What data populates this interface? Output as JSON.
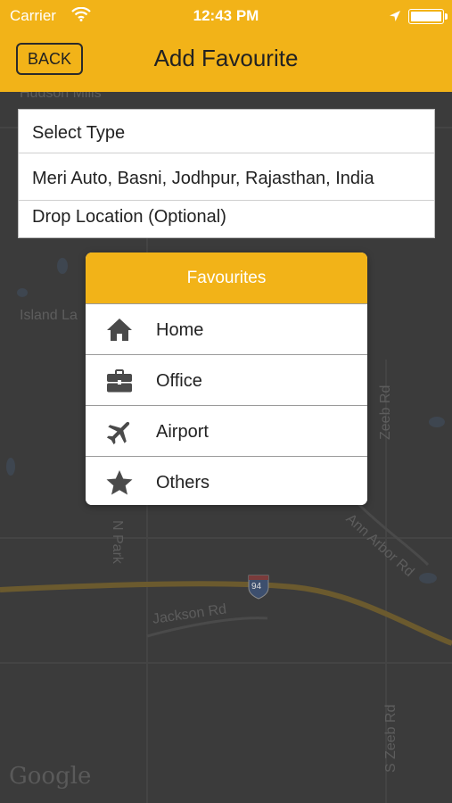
{
  "status_bar": {
    "carrier": "Carrier",
    "time": "12:43 PM",
    "icons": [
      "wifi-icon",
      "location-arrow-icon",
      "battery-icon"
    ]
  },
  "nav": {
    "back_label": "BACK",
    "title": "Add Favourite"
  },
  "form": {
    "select_type": "Select Type",
    "pickup_location": "Meri Auto, Basni, Jodhpur, Rajasthan, India",
    "drop_location_placeholder": "Drop Location (Optional)"
  },
  "favourites_popup": {
    "title": "Favourites",
    "items": [
      {
        "label": "Home",
        "icon": "home-icon"
      },
      {
        "label": "Office",
        "icon": "briefcase-icon"
      },
      {
        "label": "Airport",
        "icon": "airplane-icon"
      },
      {
        "label": "Others",
        "icon": "star-icon"
      }
    ]
  },
  "map": {
    "labels": [
      "Hudson Mills",
      "Island La",
      "N Park",
      "Zeeb Rd",
      "Ann Arbor Rd",
      "Jackson Rd",
      "S Zeeb Rd",
      "94"
    ],
    "attribution": "Google"
  },
  "colors": {
    "accent": "#f2b318",
    "map_background": "#3b3b3b",
    "text_dark": "#222222",
    "icon_gray": "#4a4a4a"
  }
}
